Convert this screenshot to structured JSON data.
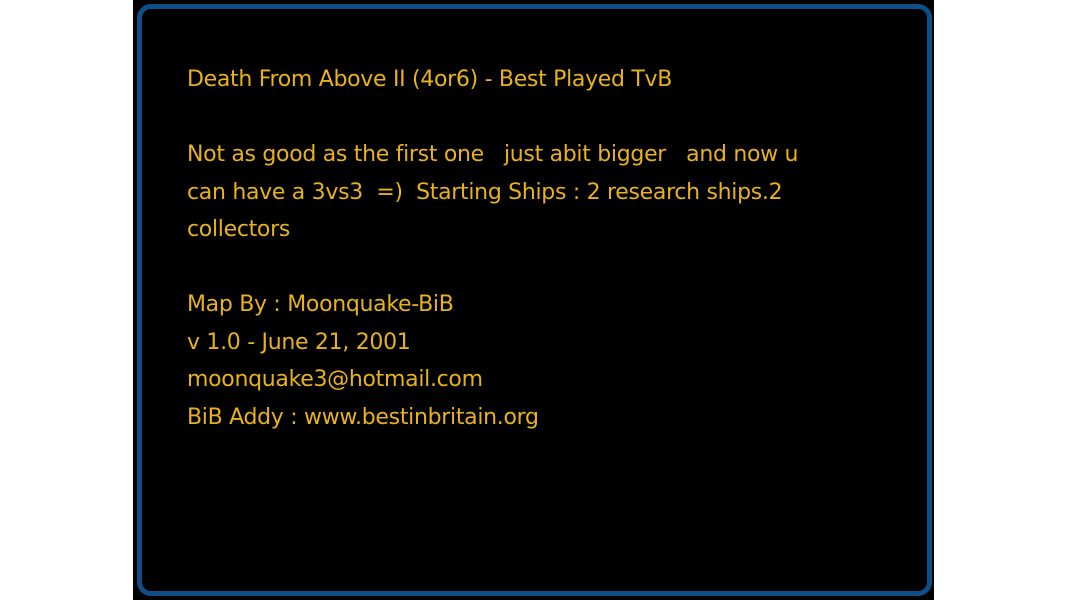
{
  "map_info": {
    "title": "Death From Above II (4or6) - Best Played TvB",
    "description_lines": [
      "Not as good as the first one   just abit bigger   and now u",
      "can have a 3vs3  =)  Starting Ships : 2 research ships.2",
      "collectors"
    ],
    "author": "Map By : Moonquake-BiB",
    "version": "v 1.0 - June 21, 2001",
    "email": "moonquake3@hotmail.com",
    "addy": "BiB Addy : www.bestinbritain.org"
  },
  "colors": {
    "text": "#e8b21c",
    "frame_border": "#0d4f86",
    "background": "#000000"
  }
}
